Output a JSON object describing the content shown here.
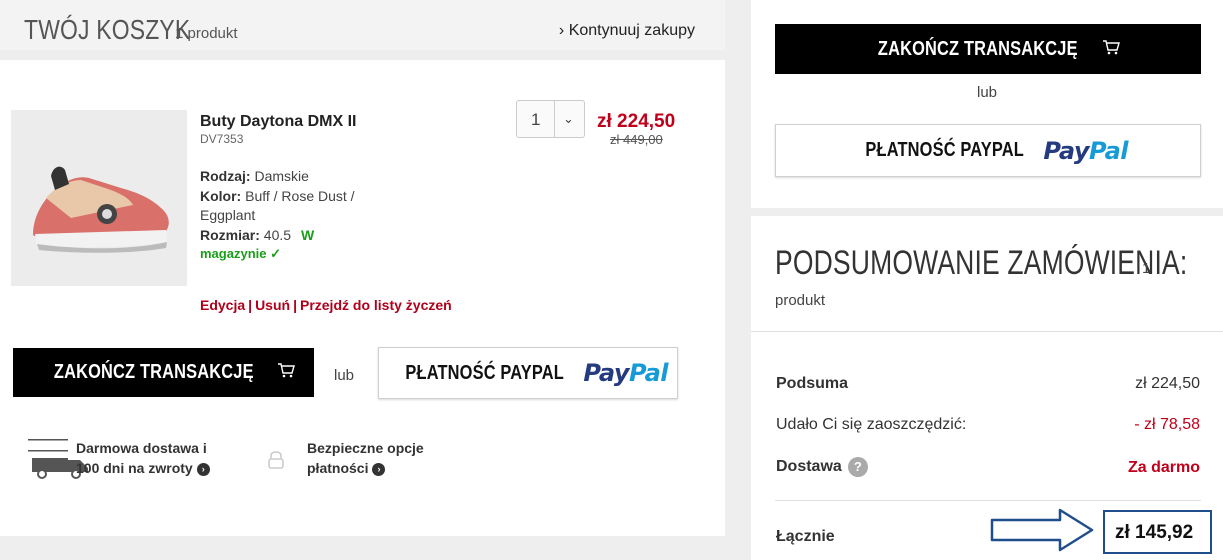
{
  "cart": {
    "title": "TWÓJ KOSZYK",
    "count": "1 produkt",
    "continue_label": "Kontynuuj zakupy"
  },
  "product": {
    "name": "Buty Daytona DMX II",
    "code": "DV7353",
    "type_label": "Rodzaj:",
    "type_value": "Damskie",
    "color_label": "Kolor:",
    "color_value_1": "Buff / Rose Dust /",
    "color_value_2": "Eggplant",
    "size_label": "Rozmiar:",
    "size_value": "40.5",
    "stock_1": "W",
    "stock_2": "magazynie ✓",
    "quantity": "1",
    "price_new": "zł 224,50",
    "price_old": "zł 449,00",
    "action_edit": "Edycja",
    "action_remove": "Usuń",
    "action_wishlist": "Przejdź do listy życzeń"
  },
  "buttons": {
    "checkout": "ZAKOŃCZ TRANSAKCJĘ",
    "or": "lub",
    "paypal_label": "PŁATNOŚĆ PAYPAL",
    "paypal_logo_1": "Pay",
    "paypal_logo_2": "Pal"
  },
  "features": {
    "shipping_1": "Darmowa dostawa i",
    "shipping_2": "100 dni na zwroty",
    "secure_1": "Bezpieczne opcje",
    "secure_2": "płatności"
  },
  "summary": {
    "title": "PODSUMOWANIE ZAMÓWIENIA:",
    "count_num": "1",
    "count_word": "produkt",
    "subtotal_label": "Podsuma",
    "subtotal_value": "zł 224,50",
    "saved_label": "Udało Ci się zaoszczędzić:",
    "saved_value": "- zł 78,58",
    "shipping_label": "Dostawa",
    "shipping_value": "Za darmo",
    "total_label": "Łącznie",
    "total_value": "zł 145,92"
  },
  "colors": {
    "accent_red": "#c0001a",
    "paypal_dark": "#253b80",
    "paypal_light": "#179bd7",
    "annotation_blue": "#1f4e8c"
  }
}
